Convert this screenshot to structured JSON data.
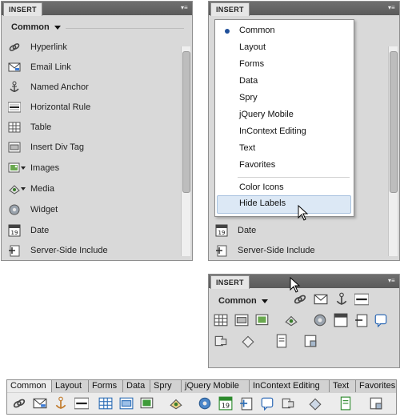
{
  "panel_title": "INSERT",
  "category": "Common",
  "items": [
    {
      "label": "Hyperlink",
      "icon": "hyperlink-icon"
    },
    {
      "label": "Email Link",
      "icon": "email-link-icon"
    },
    {
      "label": "Named Anchor",
      "icon": "named-anchor-icon"
    },
    {
      "label": "Horizontal Rule",
      "icon": "horizontal-rule-icon"
    },
    {
      "label": "Table",
      "icon": "table-icon"
    },
    {
      "label": "Insert Div Tag",
      "icon": "div-tag-icon"
    },
    {
      "label": "Images",
      "icon": "image-icon"
    },
    {
      "label": "Media",
      "icon": "media-icon"
    },
    {
      "label": "Widget",
      "icon": "widget-icon"
    },
    {
      "label": "Date",
      "icon": "date-icon"
    },
    {
      "label": "Server-Side Include",
      "icon": "ssi-icon"
    }
  ],
  "menu": {
    "items": [
      "Common",
      "Layout",
      "Forms",
      "Data",
      "Spry",
      "jQuery Mobile",
      "InContext Editing",
      "Text",
      "Favorites"
    ],
    "selected": "Common",
    "options": [
      "Color Icons",
      "Hide Labels"
    ],
    "highlighted": "Hide Labels"
  },
  "right_visible_items": [
    "Date",
    "Server-Side Include"
  ],
  "tabbar": {
    "tabs": [
      "Common",
      "Layout",
      "Forms",
      "Data",
      "Spry",
      "jQuery Mobile",
      "InContext Editing",
      "Text",
      "Favorites"
    ],
    "active": "Common"
  }
}
